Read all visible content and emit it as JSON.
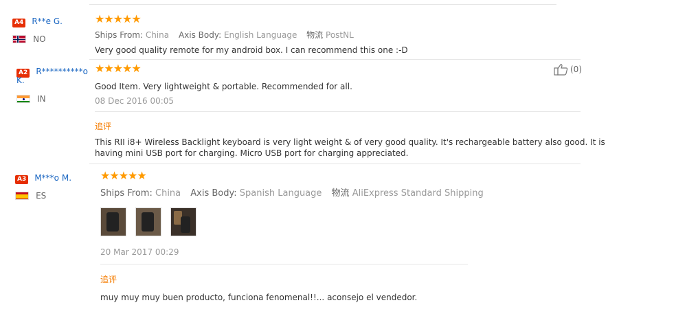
{
  "reviews": [
    {
      "badge": "A4",
      "name": "R**e G.",
      "country": "NO",
      "stars": "★★★★★",
      "ships_from_label": "Ships From:",
      "ships_from_value": "China",
      "axis_label": "Axis Body:",
      "axis_value": "English Language",
      "shipping_label": "物流",
      "shipping_value": "PostNL",
      "text": "Very good quality remote for my android box. I can recommend this one :-D"
    },
    {
      "badge": "A2",
      "name_line1": "R**********o",
      "name_line2": "K.",
      "country": "IN",
      "stars": "★★★★★",
      "text": "Good Item. Very lightweight & portable. Recommended for all.",
      "date": "08 Dec 2016 00:05",
      "like_count": "(0)",
      "additional_label": "追评",
      "additional_text_line1": "This RII i8+ Wireless Backlight keyboard is very light weight & of very good quality. It's rechargeable battery also good. It is",
      "additional_text_line2": "having mini USB port for charging. Micro USB port for charging appreciated."
    },
    {
      "badge": "A3",
      "name": "M***o M.",
      "country": "ES",
      "stars": "★★★★★",
      "ships_from_label": "Ships From:",
      "ships_from_value": "China",
      "axis_label": "Axis Body:",
      "axis_value": "Spanish Language",
      "shipping_label": "物流",
      "shipping_value": "AliExpress Standard Shipping",
      "date": "20 Mar 2017 00:29",
      "additional_label": "追评",
      "additional_text": "muy muy muy buen producto, funciona fenomenal!!... aconsejo el vendedor."
    }
  ],
  "colors": {
    "accent_orange": "#ff9a00",
    "badge_red": "#e62e04",
    "link_blue": "#1a66c2"
  }
}
